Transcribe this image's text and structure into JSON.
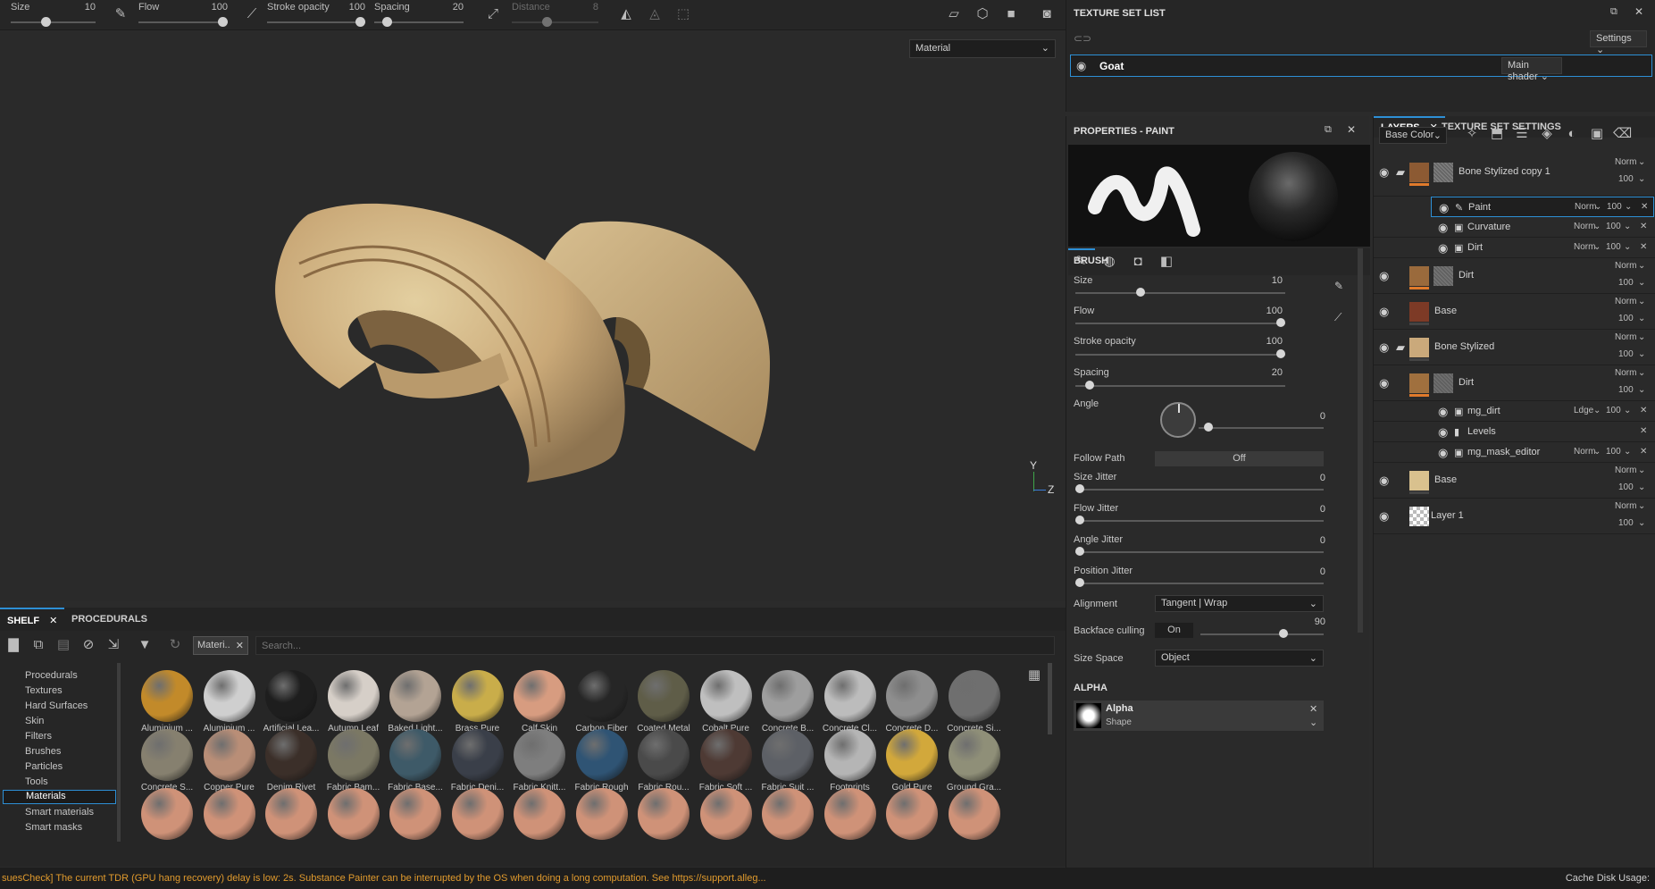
{
  "toolbar": {
    "size_label": "Size",
    "size_value": "10",
    "size_frac": 0.4,
    "flow_label": "Flow",
    "flow_value": "100",
    "flow_frac": 1.0,
    "stroke_label": "Stroke opacity",
    "stroke_value": "100",
    "stroke_frac": 1.0,
    "spacing_label": "Spacing",
    "spacing_value": "20",
    "spacing_frac": 0.1,
    "distance_label": "Distance",
    "distance_value": "8",
    "distance_frac": 0.4
  },
  "viewport": {
    "material_select": "Material",
    "axis_y": "Y",
    "axis_z": "Z"
  },
  "shelf": {
    "tabs": [
      "SHELF",
      "PROCEDURALS"
    ],
    "filter_chip": "Materi..",
    "search_placeholder": "Search...",
    "categories": [
      "Procedurals",
      "Textures",
      "Hard Surfaces",
      "Skin",
      "Filters",
      "Brushes",
      "Particles",
      "Tools",
      "Materials",
      "Smart materials",
      "Smart masks"
    ],
    "selected_category": "Materials",
    "row1": [
      {
        "label": "Aluminium ...",
        "color": "#c28a2a"
      },
      {
        "label": "Aluminium ...",
        "color": "#cfcfcf"
      },
      {
        "label": "Artificial Lea...",
        "color": "#1e1e1e"
      },
      {
        "label": "Autumn Leaf",
        "color": "#d6cfc8"
      },
      {
        "label": "Baked Light...",
        "color": "#b3a394"
      },
      {
        "label": "Brass Pure",
        "color": "#c9ad4a"
      },
      {
        "label": "Calf Skin",
        "color": "#d79c80"
      },
      {
        "label": "Carbon Fiber",
        "color": "#262626"
      },
      {
        "label": "Coated Metal",
        "color": "#5f5d48"
      },
      {
        "label": "Cobalt Pure",
        "color": "#bfbfbf"
      },
      {
        "label": "Concrete B...",
        "color": "#9e9e9e"
      },
      {
        "label": "Concrete Cl...",
        "color": "#bcbcbc"
      },
      {
        "label": "Concrete D...",
        "color": "#8e8e8e"
      },
      {
        "label": "Concrete Si...",
        "color": "#6f6f6f"
      }
    ],
    "row2": [
      {
        "label": "Concrete S...",
        "color": "#86806f"
      },
      {
        "label": "Copper Pure",
        "color": "#b98e77"
      },
      {
        "label": "Denim Rivet",
        "color": "#3b2f29"
      },
      {
        "label": "Fabric Bam...",
        "color": "#7b7864"
      },
      {
        "label": "Fabric Base...",
        "color": "#3e5a68"
      },
      {
        "label": "Fabric Deni...",
        "color": "#3a3f49"
      },
      {
        "label": "Fabric Knitt...",
        "color": "#7e7e7e"
      },
      {
        "label": "Fabric Rough",
        "color": "#2f5474"
      },
      {
        "label": "Fabric Rou...",
        "color": "#4a4a4a"
      },
      {
        "label": "Fabric Soft ...",
        "color": "#4e3a34"
      },
      {
        "label": "Fabric Suit ...",
        "color": "#5d6066"
      },
      {
        "label": "Footprints",
        "color": "#b5b5b5"
      },
      {
        "label": "Gold Pure",
        "color": "#d2a83b"
      },
      {
        "label": "Ground Gra...",
        "color": "#8f8f78"
      }
    ],
    "row3_count": 14,
    "row3_color": "#cf9278"
  },
  "status": {
    "message": "suesCheck] The current TDR (GPU hang recovery) delay is low: 2s. Substance Painter can be interrupted by the OS when doing a long computation. See https://support.alleg...",
    "cache": "Cache Disk Usage:"
  },
  "texture_set_list": {
    "title": "TEXTURE SET LIST",
    "settings": "Settings",
    "set_name": "Goat",
    "shader": "Main shader"
  },
  "properties": {
    "title": "PROPERTIES - PAINT",
    "brush_heading": "BRUSH",
    "size_label": "Size",
    "size_value": "10",
    "size_frac": 0.3,
    "flow_label": "Flow",
    "flow_value": "100",
    "flow_frac": 1.0,
    "stroke_label": "Stroke opacity",
    "stroke_value": "100",
    "stroke_frac": 1.0,
    "spacing_label": "Spacing",
    "spacing_value": "20",
    "spacing_frac": 0.05,
    "angle_label": "Angle",
    "angle_value": "0",
    "follow_label": "Follow Path",
    "follow_value": "Off",
    "size_jitter_label": "Size Jitter",
    "size_jitter_value": "0",
    "flow_jitter_label": "Flow Jitter",
    "flow_jitter_value": "0",
    "angle_jitter_label": "Angle Jitter",
    "angle_jitter_value": "0",
    "pos_jitter_label": "Position Jitter",
    "pos_jitter_value": "0",
    "alignment_label": "Alignment",
    "alignment_value": "Tangent | Wrap",
    "backface_label": "Backface culling",
    "backface_toggle": "On",
    "backface_value": "90",
    "sizespace_label": "Size Space",
    "sizespace_value": "Object",
    "alpha_heading": "ALPHA",
    "alpha_name": "Alpha",
    "alpha_sub": "Shape"
  },
  "layers": {
    "tabs": [
      "LAYERS",
      "TEXTURE SET SETTINGS"
    ],
    "channel": "Base Color",
    "rows": [
      {
        "name": "Bone Stylized copy 1",
        "blend": "Norm",
        "opacity": "100",
        "type": "folder",
        "color": "#8c5a33",
        "mask": "#8a8a8a"
      },
      {
        "name": "Paint",
        "blend": "Norm",
        "opacity": "100",
        "type": "effect",
        "icon": "paint"
      },
      {
        "name": "Curvature",
        "blend": "Norm",
        "opacity": "100",
        "type": "effect",
        "icon": "filter"
      },
      {
        "name": "Dirt",
        "blend": "Norm",
        "opacity": "100",
        "type": "effect",
        "icon": "filter"
      },
      {
        "name": "Dirt",
        "blend": "Norm",
        "opacity": "100",
        "type": "layer",
        "color": "#9a6a3c",
        "mask": "#7d7d7d"
      },
      {
        "name": "Base",
        "blend": "Norm",
        "opacity": "100",
        "type": "layer",
        "color": "#7d3a26"
      },
      {
        "name": "Bone Stylized",
        "blend": "Norm",
        "opacity": "100",
        "type": "folder",
        "color": "#caa97b"
      },
      {
        "name": "Dirt",
        "blend": "Norm",
        "opacity": "100",
        "type": "layer",
        "color": "#a0703e",
        "mask": "#777777"
      },
      {
        "name": "mg_dirt",
        "blend": "Ldge",
        "opacity": "100",
        "type": "effect",
        "icon": "filter"
      },
      {
        "name": "Levels",
        "blend": "",
        "opacity": "",
        "type": "effect",
        "icon": "levels"
      },
      {
        "name": "mg_mask_editor",
        "blend": "Norm",
        "opacity": "100",
        "type": "effect",
        "icon": "filter"
      },
      {
        "name": "Base",
        "blend": "Norm",
        "opacity": "100",
        "type": "layer",
        "color": "#d9c18e"
      },
      {
        "name": "Layer 1",
        "blend": "Norm",
        "opacity": "100",
        "type": "layer",
        "color": "checker"
      }
    ]
  }
}
